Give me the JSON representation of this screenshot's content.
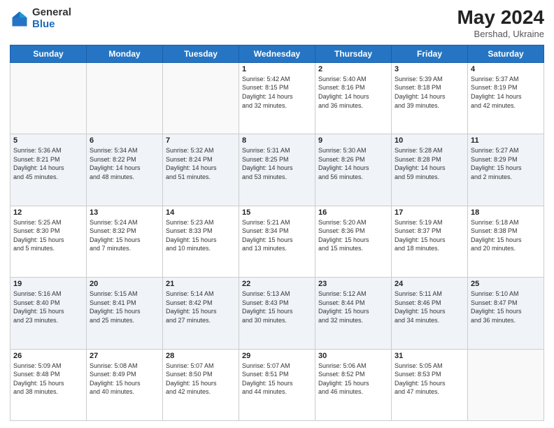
{
  "header": {
    "logo_general": "General",
    "logo_blue": "Blue",
    "month_year": "May 2024",
    "location": "Bershad, Ukraine"
  },
  "weekdays": [
    "Sunday",
    "Monday",
    "Tuesday",
    "Wednesday",
    "Thursday",
    "Friday",
    "Saturday"
  ],
  "weeks": [
    [
      {
        "day": "",
        "info": ""
      },
      {
        "day": "",
        "info": ""
      },
      {
        "day": "",
        "info": ""
      },
      {
        "day": "1",
        "info": "Sunrise: 5:42 AM\nSunset: 8:15 PM\nDaylight: 14 hours\nand 32 minutes."
      },
      {
        "day": "2",
        "info": "Sunrise: 5:40 AM\nSunset: 8:16 PM\nDaylight: 14 hours\nand 36 minutes."
      },
      {
        "day": "3",
        "info": "Sunrise: 5:39 AM\nSunset: 8:18 PM\nDaylight: 14 hours\nand 39 minutes."
      },
      {
        "day": "4",
        "info": "Sunrise: 5:37 AM\nSunset: 8:19 PM\nDaylight: 14 hours\nand 42 minutes."
      }
    ],
    [
      {
        "day": "5",
        "info": "Sunrise: 5:36 AM\nSunset: 8:21 PM\nDaylight: 14 hours\nand 45 minutes."
      },
      {
        "day": "6",
        "info": "Sunrise: 5:34 AM\nSunset: 8:22 PM\nDaylight: 14 hours\nand 48 minutes."
      },
      {
        "day": "7",
        "info": "Sunrise: 5:32 AM\nSunset: 8:24 PM\nDaylight: 14 hours\nand 51 minutes."
      },
      {
        "day": "8",
        "info": "Sunrise: 5:31 AM\nSunset: 8:25 PM\nDaylight: 14 hours\nand 53 minutes."
      },
      {
        "day": "9",
        "info": "Sunrise: 5:30 AM\nSunset: 8:26 PM\nDaylight: 14 hours\nand 56 minutes."
      },
      {
        "day": "10",
        "info": "Sunrise: 5:28 AM\nSunset: 8:28 PM\nDaylight: 14 hours\nand 59 minutes."
      },
      {
        "day": "11",
        "info": "Sunrise: 5:27 AM\nSunset: 8:29 PM\nDaylight: 15 hours\nand 2 minutes."
      }
    ],
    [
      {
        "day": "12",
        "info": "Sunrise: 5:25 AM\nSunset: 8:30 PM\nDaylight: 15 hours\nand 5 minutes."
      },
      {
        "day": "13",
        "info": "Sunrise: 5:24 AM\nSunset: 8:32 PM\nDaylight: 15 hours\nand 7 minutes."
      },
      {
        "day": "14",
        "info": "Sunrise: 5:23 AM\nSunset: 8:33 PM\nDaylight: 15 hours\nand 10 minutes."
      },
      {
        "day": "15",
        "info": "Sunrise: 5:21 AM\nSunset: 8:34 PM\nDaylight: 15 hours\nand 13 minutes."
      },
      {
        "day": "16",
        "info": "Sunrise: 5:20 AM\nSunset: 8:36 PM\nDaylight: 15 hours\nand 15 minutes."
      },
      {
        "day": "17",
        "info": "Sunrise: 5:19 AM\nSunset: 8:37 PM\nDaylight: 15 hours\nand 18 minutes."
      },
      {
        "day": "18",
        "info": "Sunrise: 5:18 AM\nSunset: 8:38 PM\nDaylight: 15 hours\nand 20 minutes."
      }
    ],
    [
      {
        "day": "19",
        "info": "Sunrise: 5:16 AM\nSunset: 8:40 PM\nDaylight: 15 hours\nand 23 minutes."
      },
      {
        "day": "20",
        "info": "Sunrise: 5:15 AM\nSunset: 8:41 PM\nDaylight: 15 hours\nand 25 minutes."
      },
      {
        "day": "21",
        "info": "Sunrise: 5:14 AM\nSunset: 8:42 PM\nDaylight: 15 hours\nand 27 minutes."
      },
      {
        "day": "22",
        "info": "Sunrise: 5:13 AM\nSunset: 8:43 PM\nDaylight: 15 hours\nand 30 minutes."
      },
      {
        "day": "23",
        "info": "Sunrise: 5:12 AM\nSunset: 8:44 PM\nDaylight: 15 hours\nand 32 minutes."
      },
      {
        "day": "24",
        "info": "Sunrise: 5:11 AM\nSunset: 8:46 PM\nDaylight: 15 hours\nand 34 minutes."
      },
      {
        "day": "25",
        "info": "Sunrise: 5:10 AM\nSunset: 8:47 PM\nDaylight: 15 hours\nand 36 minutes."
      }
    ],
    [
      {
        "day": "26",
        "info": "Sunrise: 5:09 AM\nSunset: 8:48 PM\nDaylight: 15 hours\nand 38 minutes."
      },
      {
        "day": "27",
        "info": "Sunrise: 5:08 AM\nSunset: 8:49 PM\nDaylight: 15 hours\nand 40 minutes."
      },
      {
        "day": "28",
        "info": "Sunrise: 5:07 AM\nSunset: 8:50 PM\nDaylight: 15 hours\nand 42 minutes."
      },
      {
        "day": "29",
        "info": "Sunrise: 5:07 AM\nSunset: 8:51 PM\nDaylight: 15 hours\nand 44 minutes."
      },
      {
        "day": "30",
        "info": "Sunrise: 5:06 AM\nSunset: 8:52 PM\nDaylight: 15 hours\nand 46 minutes."
      },
      {
        "day": "31",
        "info": "Sunrise: 5:05 AM\nSunset: 8:53 PM\nDaylight: 15 hours\nand 47 minutes."
      },
      {
        "day": "",
        "info": ""
      }
    ]
  ]
}
